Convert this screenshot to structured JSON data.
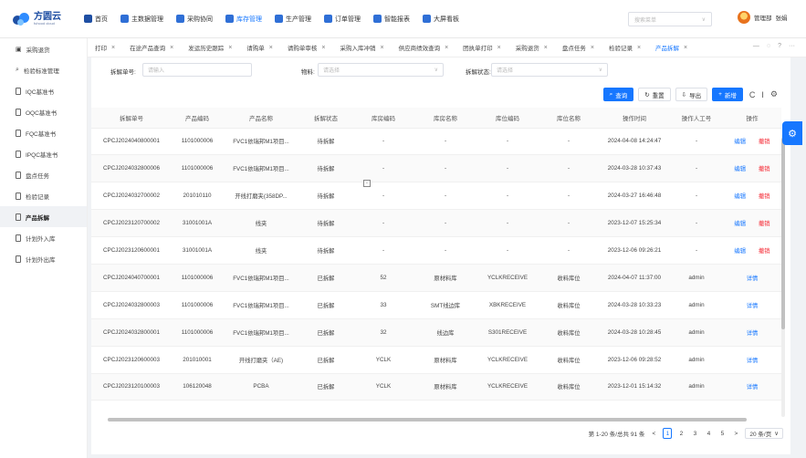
{
  "logo": {
    "name": "方圆云",
    "sub": "fuhood cloud"
  },
  "topnav": [
    {
      "label": "首页",
      "icon": "home-icon",
      "color": "#1f4fa3"
    },
    {
      "label": "主数据管理",
      "icon": "database-icon",
      "color": "#2f6fd6"
    },
    {
      "label": "采购协同",
      "icon": "cart-icon",
      "color": "#2f6fd6"
    },
    {
      "label": "库存管理",
      "icon": "warehouse-icon",
      "color": "#2f6fd6",
      "active": true
    },
    {
      "label": "生产管理",
      "icon": "factory-icon",
      "color": "#2f6fd6"
    },
    {
      "label": "订单管理",
      "icon": "order-icon",
      "color": "#2f6fd6"
    },
    {
      "label": "智能报表",
      "icon": "report-icon",
      "color": "#2f6fd6"
    },
    {
      "label": "大屏看板",
      "icon": "dashboard-icon",
      "color": "#2f6fd6"
    }
  ],
  "search": {
    "placeholder": "搜索菜单"
  },
  "user": {
    "role": "管理部",
    "name": "张娟"
  },
  "sidebar": [
    {
      "label": "采购退货",
      "icon": "return-icon"
    },
    {
      "label": "检验标准管理",
      "icon": "search-icon"
    },
    {
      "label": "IQC基准书",
      "icon": "document-icon"
    },
    {
      "label": "OQC基准书",
      "icon": "document-icon"
    },
    {
      "label": "FQC基准书",
      "icon": "document-icon"
    },
    {
      "label": "IPQC基准书",
      "icon": "document-icon"
    },
    {
      "label": "盘点任务",
      "icon": "document-icon"
    },
    {
      "label": "检验记录",
      "icon": "document-icon"
    },
    {
      "label": "产品拆解",
      "icon": "document-icon",
      "active": true
    },
    {
      "label": "计划外入库",
      "icon": "document-icon"
    },
    {
      "label": "计划外出库",
      "icon": "document-icon"
    }
  ],
  "tabs": [
    {
      "label": "打印"
    },
    {
      "label": "在途产品查询"
    },
    {
      "label": "发运历史跟踪"
    },
    {
      "label": "请购单"
    },
    {
      "label": "请购单审核"
    },
    {
      "label": "采购入库冲销"
    },
    {
      "label": "供应商绩效查询"
    },
    {
      "label": "团执单打印"
    },
    {
      "label": "采购退货"
    },
    {
      "label": "盘点任务"
    },
    {
      "label": "检验记录"
    },
    {
      "label": "产品拆解",
      "active": true
    }
  ],
  "filters": {
    "order_label": "拆解单号:",
    "order_placeholder": "请输入",
    "material_label": "物料:",
    "material_placeholder": "请选择",
    "status_label": "拆解状态:",
    "status_placeholder": "请选择"
  },
  "actions": {
    "search": "查询",
    "reset": "重置",
    "export": "导出",
    "add": "新增"
  },
  "table": {
    "headers": [
      "拆解单号",
      "产品编码",
      "产品名称",
      "拆解状态",
      "库房编码",
      "库房名称",
      "库位编码",
      "库位名称",
      "操作时间",
      "操作人工号",
      "操作"
    ],
    "rows": [
      {
        "c": [
          "CPCJ2024040800001",
          "1101000006",
          "FVC1依瑞邦M1项目...",
          "待拆解",
          "-",
          "-",
          "-",
          "-",
          "2024-04-08 14:24:47",
          "-"
        ],
        "ops": [
          "编辑",
          "撤销"
        ]
      },
      {
        "c": [
          "CPCJ2024032800006",
          "1101000006",
          "FVC1依瑞邦M1项目...",
          "待拆解",
          "-",
          "-",
          "-",
          "-",
          "2024-03-28 10:37:43",
          "-"
        ],
        "ops": [
          "编辑",
          "撤销"
        ]
      },
      {
        "c": [
          "CPCJ2024032700002",
          "201010110",
          "开线打磨夹(358DP...",
          "待拆解",
          "-",
          "-",
          "-",
          "-",
          "2024-03-27 16:46:48",
          "-"
        ],
        "ops": [
          "编辑",
          "撤销"
        ]
      },
      {
        "c": [
          "CPCJ2023120700002",
          "31001001A",
          "线夹",
          "待拆解",
          "-",
          "-",
          "-",
          "-",
          "2023-12-07 15:25:34",
          "-"
        ],
        "ops": [
          "编辑",
          "撤销"
        ]
      },
      {
        "c": [
          "CPCJ2023120600001",
          "31001001A",
          "线夹",
          "待拆解",
          "-",
          "-",
          "-",
          "-",
          "2023-12-06 09:26:21",
          "-"
        ],
        "ops": [
          "编辑",
          "撤销"
        ]
      },
      {
        "c": [
          "CPCJ2024040700001",
          "1101000006",
          "FVC1依瑞邦M1项目...",
          "已拆解",
          "52",
          "原材料库",
          "YCLKRECEIVE",
          "收料库位",
          "2024-04-07 11:37:00",
          "admin"
        ],
        "ops": [
          "详情"
        ]
      },
      {
        "c": [
          "CPCJ2024032800003",
          "1101000006",
          "FVC1依瑞邦M1项目...",
          "已拆解",
          "33",
          "SMT线边库",
          "XBKRECEIVE",
          "收料库位",
          "2024-03-28 10:33:23",
          "admin"
        ],
        "ops": [
          "详情"
        ]
      },
      {
        "c": [
          "CPCJ2024032800001",
          "1101000006",
          "FVC1依瑞邦M1项目...",
          "已拆解",
          "32",
          "线边库",
          "S301RECEIVE",
          "收料库位",
          "2024-03-28 10:28:45",
          "admin"
        ],
        "ops": [
          "详情"
        ]
      },
      {
        "c": [
          "CPCJ2023120600003",
          "201010001",
          "开线打磨夹（AE)",
          "已拆解",
          "YCLK",
          "原材料库",
          "YCLKRECEIVE",
          "收料库位",
          "2023-12-06 09:28:52",
          "admin"
        ],
        "ops": [
          "详情"
        ]
      },
      {
        "c": [
          "CPCJ2023120100003",
          "106120048",
          "PCBA",
          "已拆解",
          "YCLK",
          "原材料库",
          "YCLKRECEIVE",
          "收料库位",
          "2023-12-01 15:14:32",
          "admin"
        ],
        "ops": [
          "详情"
        ]
      }
    ]
  },
  "pager": {
    "summary": "第 1-20 条/总共 91 条",
    "pages": [
      "1",
      "2",
      "3",
      "4",
      "5"
    ],
    "next": ">",
    "prev": "<",
    "size": "20 条/页"
  },
  "colors": {
    "primary": "#1677ff",
    "danger": "#f5222d"
  }
}
